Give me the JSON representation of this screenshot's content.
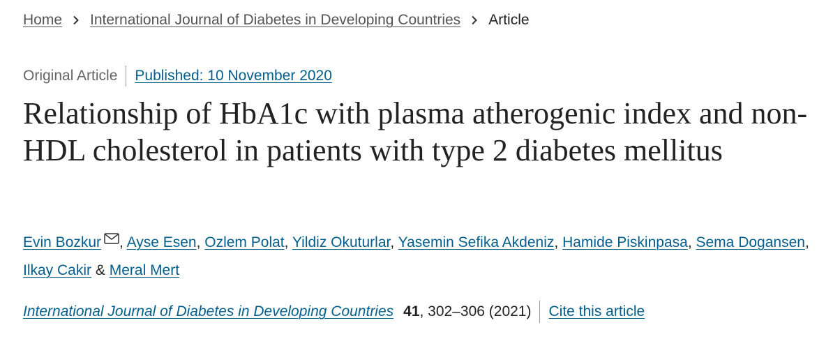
{
  "breadcrumb": {
    "home": "Home",
    "journal": "International Journal of Diabetes in Developing Countries",
    "current": "Article"
  },
  "meta": {
    "article_type": "Original Article",
    "published": "Published: 10 November 2020"
  },
  "title": "Relationship of HbA1c with plasma atherogenic index and non-HDL cholesterol in patients with type 2 diabetes mellitus",
  "authors": [
    "Evin Bozkur",
    "Ayse Esen",
    "Ozlem Polat",
    "Yildiz Okuturlar",
    "Yasemin Sefika Akdeniz",
    "Hamide Piskinpasa",
    "Sema Dogansen",
    "Ilkay Cakir",
    "Meral Mert"
  ],
  "authors_separator": ", ",
  "authors_last_separator": " & ",
  "citation": {
    "journal": "International Journal of Diabetes in Developing Countries",
    "volume": "41",
    "pages_year": ", 302–306 (2021)",
    "cite_link": "Cite this article"
  },
  "icons": {
    "chevron": "chevron-right-icon",
    "mail": "mail-icon"
  },
  "colors": {
    "link": "#025e8d",
    "text": "#222222",
    "muted": "#666666"
  }
}
